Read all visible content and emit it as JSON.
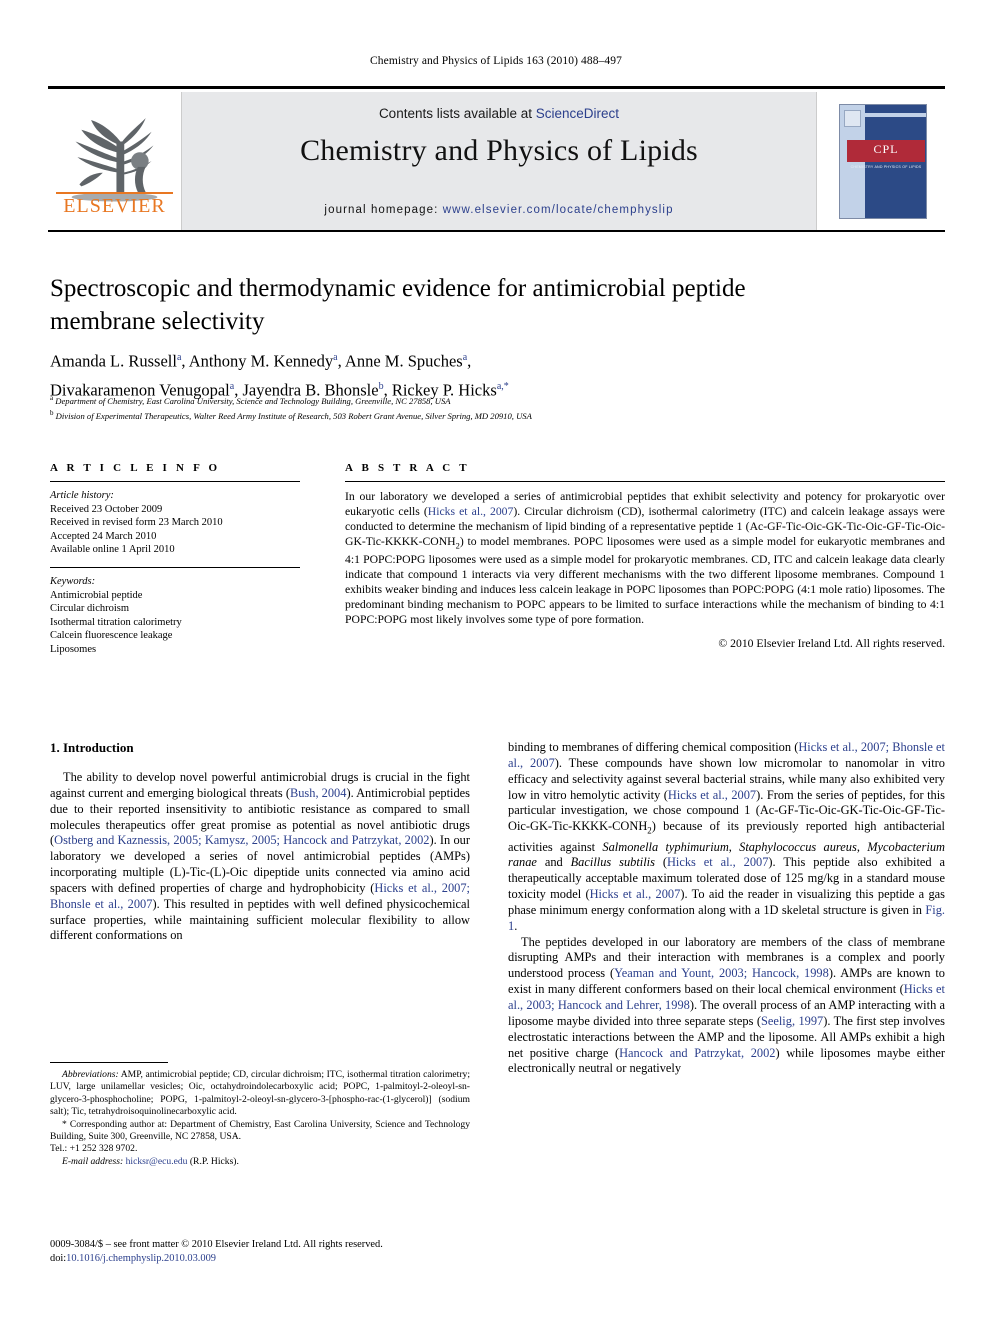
{
  "running_head": "Chemistry and Physics of Lipids 163 (2010) 488–497",
  "masthead": {
    "contents_prefix": "Contents lists available at ",
    "sciencedirect": "ScienceDirect",
    "journal_title": "Chemistry and Physics of Lipids",
    "homepage_prefix": "journal homepage:",
    "homepage_url": "www.elsevier.com/locate/chemphyslip",
    "publisher_wordmark": "ELSEVIER",
    "cover_acronym": "CPL",
    "cover_subtitle": "CHEMISTRY AND PHYSICS OF LIPIDS",
    "link_color": "#2b3f8c",
    "elsevier_orange": "#E87722",
    "cover_red": "#b02a39",
    "cover_blue": "#2c4a86"
  },
  "article": {
    "title": "Spectroscopic and thermodynamic evidence for antimicrobial peptide membrane selectivity",
    "authors_line1": "Amanda L. Russell",
    "authors_line1_b": ", Anthony M. Kennedy",
    "authors_line1_c": ", Anne M. Spuches",
    "authors_line2": "Divakaramenon Venugopal",
    "authors_line2_b": ", Jayendra B. Bhonsle",
    "authors_line2_c": ", Rickey P. Hicks",
    "affiliation_a": "Department of Chemistry, East Carolina University, Science and Technology Building, Greenville, NC 27858, USA",
    "affiliation_b": "Division of Experimental Therapeutics, Walter Reed Army Institute of Research, 503 Robert Grant Avenue, Silver Spring, MD 20910, USA"
  },
  "info": {
    "heading": "A R T I C L E    I N F O",
    "history_label": "Article history:",
    "history": [
      "Received 23 October 2009",
      "Received in revised form 23 March 2010",
      "Accepted 24 March 2010",
      "Available online 1 April 2010"
    ],
    "keywords_label": "Keywords:",
    "keywords": [
      "Antimicrobial peptide",
      "Circular dichroism",
      "Isothermal titration calorimetry",
      "Calcein fluorescence leakage",
      "Liposomes"
    ]
  },
  "abstract": {
    "heading": "A B S T R A C T",
    "p1": "In our laboratory we developed a series of antimicrobial peptides that exhibit selectivity and potency for prokaryotic over eukaryotic cells (",
    "cite1": "Hicks et al., 2007",
    "p2": "). Circular dichroism (CD), isothermal calorimetry (ITC) and calcein leakage assays were conducted to determine the mechanism of lipid binding of a representative peptide 1 (Ac-GF-Tic-Oic-GK-Tic-Oic-GF-Tic-Oic-GK-Tic-KKKK-CONH",
    "p2_sub": "2",
    "p3": ") to model membranes. POPC liposomes were used as a simple model for eukaryotic membranes and 4:1 POPC:POPG liposomes were used as a simple model for prokaryotic membranes. CD, ITC and calcein leakage data clearly indicate that compound 1 interacts via very different mechanisms with the two different liposome membranes. Compound 1 exhibits weaker binding and induces less calcein leakage in POPC liposomes than POPC:POPG (4:1 mole ratio) liposomes. The predominant binding mechanism to POPC appears to be limited to surface interactions while the mechanism of binding to 4:1 POPC:POPG most likely involves some type of pore formation.",
    "copyright": "© 2010 Elsevier Ireland Ltd. All rights reserved."
  },
  "body": {
    "section_heading": "1. Introduction",
    "left_p1_a": "The ability to develop novel powerful antimicrobial drugs is crucial in the fight against current and emerging biological threats (",
    "left_p1_cite1": "Bush, 2004",
    "left_p1_b": "). Antimicrobial peptides due to their reported insensitivity to antibiotic resistance as compared to small molecules therapeutics offer great promise as potential as novel antibiotic drugs (",
    "left_p1_cite2": "Ostberg and Kaznessis, 2005; Kamysz, 2005; Hancock and Patrzykat, 2002",
    "left_p1_c": "). In our laboratory we developed a series of novel antimicrobial peptides (AMPs) incorporating multiple (L)-Tic-(L)-Oic dipeptide units connected via amino acid spacers with defined properties of charge and hydrophobicity (",
    "left_p1_cite3": "Hicks et al., 2007; Bhonsle et al., 2007",
    "left_p1_d": "). This resulted in peptides with well defined physicochemical surface properties, while maintaining sufficient molecular flexibility to allow different conformations on",
    "right_p1_a": "binding to membranes of differing chemical composition (",
    "right_p1_cite1": "Hicks et al., 2007; Bhonsle et al., 2007",
    "right_p1_b": "). These compounds have shown low micromolar to nanomolar in vitro efficacy and selectivity against several bacterial strains, while many also exhibited very low in vitro hemolytic activity (",
    "right_p1_cite2": "Hicks et al., 2007",
    "right_p1_c": "). From the series of peptides, for this particular investigation, we chose compound 1 (Ac-GF-Tic-Oic-GK-Tic-Oic-GF-Tic-Oic-GK-Tic-KKKK-CONH",
    "right_p1_sub": "2",
    "right_p1_d": ") because of its previously reported high antibacterial activities against ",
    "right_sp1": "Salmonella typhimurium",
    "right_p1_e": ", ",
    "right_sp2": "Staphylococcus aureus",
    "right_p1_f": ", ",
    "right_sp3": "Mycobacterium ranae",
    "right_p1_g": " and ",
    "right_sp4": "Bacillus subtilis",
    "right_p1_h": " (",
    "right_p1_cite3": "Hicks et al., 2007",
    "right_p1_i": "). This peptide also exhibited a therapeutically acceptable maximum tolerated dose of 125 mg/kg in a standard mouse toxicity model (",
    "right_p1_cite4": "Hicks et al., 2007",
    "right_p1_j": "). To aid the reader in visualizing this peptide a gas phase minimum energy conformation along with a 1D skeletal structure is given in ",
    "right_p1_figref": "Fig. 1",
    "right_p1_k": ".",
    "right_p2_a": "The peptides developed in our laboratory are members of the class of membrane disrupting AMPs and their interaction with membranes is a complex and poorly understood process (",
    "right_p2_cite1": "Yeaman and Yount, 2003; Hancock, 1998",
    "right_p2_b": "). AMPs are known to exist in many different conformers based on their local chemical environment (",
    "right_p2_cite2": "Hicks et al., 2003; Hancock and Lehrer, 1998",
    "right_p2_c": "). The overall process of an AMP interacting with a liposome maybe divided into three separate steps (",
    "right_p2_cite3": "Seelig, 1997",
    "right_p2_d": "). The first step involves electrostatic interactions between the AMP and the liposome. All AMPs exhibit a high net positive charge (",
    "right_p2_cite4": "Hancock and Patrzykat, 2002",
    "right_p2_e": ") while liposomes maybe either electronically neutral or negatively"
  },
  "footnotes": {
    "abbrev_label": "Abbreviations:",
    "abbrev_text": " AMP, antimicrobial peptide; CD, circular dichroism; ITC, isothermal titration calorimetry; LUV, large unilamellar vesicles; Oic, octahydroindolecarboxylic acid; POPC, 1-palmitoyl-2-oleoyl-sn-glycero-3-phosphocholine; POPG, 1-palmitoyl-2-oleoyl-sn-glycero-3-[phospho-rac-(1-glycerol)] (sodium salt); Tic, tetrahydroisoquinolinecarboxylic acid.",
    "corresp": "* Corresponding author at: Department of Chemistry, East Carolina University, Science and Technology Building, Suite 300, Greenville, NC 27858, USA.",
    "tel": "Tel.: +1 252 328 9702.",
    "email_label": "E-mail address:",
    "email": "hicksr@ecu.edu",
    "email_suffix": " (R.P. Hicks).",
    "issn_line": "0009-3084/$ – see front matter © 2010 Elsevier Ireland Ltd. All rights reserved.",
    "doi_label": "doi:",
    "doi": "10.1016/j.chemphyslip.2010.03.009"
  }
}
